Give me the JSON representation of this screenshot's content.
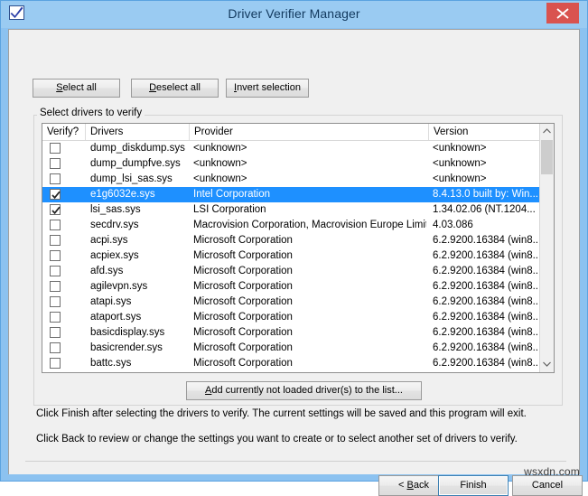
{
  "window": {
    "title": "Driver Verifier Manager",
    "icon": "checkbox-check-icon",
    "close_label": "×",
    "frame_color": "#8cc2f0",
    "titlebar_color": "#9acbf2",
    "close_color": "#d9534f",
    "client_color": "#f0f0f0",
    "selection_color": "#1e90ff"
  },
  "toolbar": {
    "select_all": "Select all",
    "select_all_accel": "S",
    "deselect_all": "Deselect all",
    "deselect_all_accel": "D",
    "invert_selection": "Invert selection",
    "invert_selection_accel": "I"
  },
  "group": {
    "label": "Select drivers to verify",
    "add_button": "Add currently not loaded driver(s) to the list...",
    "add_button_accel": "A"
  },
  "list": {
    "columns": [
      {
        "key": "verify",
        "label": "Verify?"
      },
      {
        "key": "drivers",
        "label": "Drivers"
      },
      {
        "key": "provider",
        "label": "Provider"
      },
      {
        "key": "version",
        "label": "Version"
      }
    ],
    "rows": [
      {
        "checked": false,
        "selected": false,
        "driver": "dump_diskdump.sys",
        "provider": "<unknown>",
        "version": "<unknown>"
      },
      {
        "checked": false,
        "selected": false,
        "driver": "dump_dumpfve.sys",
        "provider": "<unknown>",
        "version": "<unknown>"
      },
      {
        "checked": false,
        "selected": false,
        "driver": "dump_lsi_sas.sys",
        "provider": "<unknown>",
        "version": "<unknown>"
      },
      {
        "checked": true,
        "selected": true,
        "driver": "e1g6032e.sys",
        "provider": "Intel Corporation",
        "version": "8.4.13.0 built by: Win..."
      },
      {
        "checked": true,
        "selected": false,
        "driver": "lsi_sas.sys",
        "provider": "LSI Corporation",
        "version": "1.34.02.06 (NT.1204..."
      },
      {
        "checked": false,
        "selected": false,
        "driver": "secdrv.sys",
        "provider": "Macrovision Corporation, Macrovision Europe Limite...",
        "version": "4.03.086"
      },
      {
        "checked": false,
        "selected": false,
        "driver": "acpi.sys",
        "provider": "Microsoft Corporation",
        "version": "6.2.9200.16384 (win8..."
      },
      {
        "checked": false,
        "selected": false,
        "driver": "acpiex.sys",
        "provider": "Microsoft Corporation",
        "version": "6.2.9200.16384 (win8..."
      },
      {
        "checked": false,
        "selected": false,
        "driver": "afd.sys",
        "provider": "Microsoft Corporation",
        "version": "6.2.9200.16384 (win8..."
      },
      {
        "checked": false,
        "selected": false,
        "driver": "agilevpn.sys",
        "provider": "Microsoft Corporation",
        "version": "6.2.9200.16384 (win8..."
      },
      {
        "checked": false,
        "selected": false,
        "driver": "atapi.sys",
        "provider": "Microsoft Corporation",
        "version": "6.2.9200.16384 (win8..."
      },
      {
        "checked": false,
        "selected": false,
        "driver": "ataport.sys",
        "provider": "Microsoft Corporation",
        "version": "6.2.9200.16384 (win8..."
      },
      {
        "checked": false,
        "selected": false,
        "driver": "basicdisplay.sys",
        "provider": "Microsoft Corporation",
        "version": "6.2.9200.16384 (win8..."
      },
      {
        "checked": false,
        "selected": false,
        "driver": "basicrender.sys",
        "provider": "Microsoft Corporation",
        "version": "6.2.9200.16384 (win8..."
      },
      {
        "checked": false,
        "selected": false,
        "driver": "battc.sys",
        "provider": "Microsoft Corporation",
        "version": "6.2.9200.16384 (win8..."
      }
    ]
  },
  "instructions": {
    "line1": "Click Finish after selecting the drivers to verify. The current settings will be saved and this program will exit.",
    "line2": "Click Back to review or change the settings you want to create or to select another set of drivers to verify."
  },
  "footer": {
    "back": "< Back",
    "back_accel": "B",
    "finish": "Finish",
    "cancel": "Cancel"
  },
  "watermark": "wsxdn.com"
}
